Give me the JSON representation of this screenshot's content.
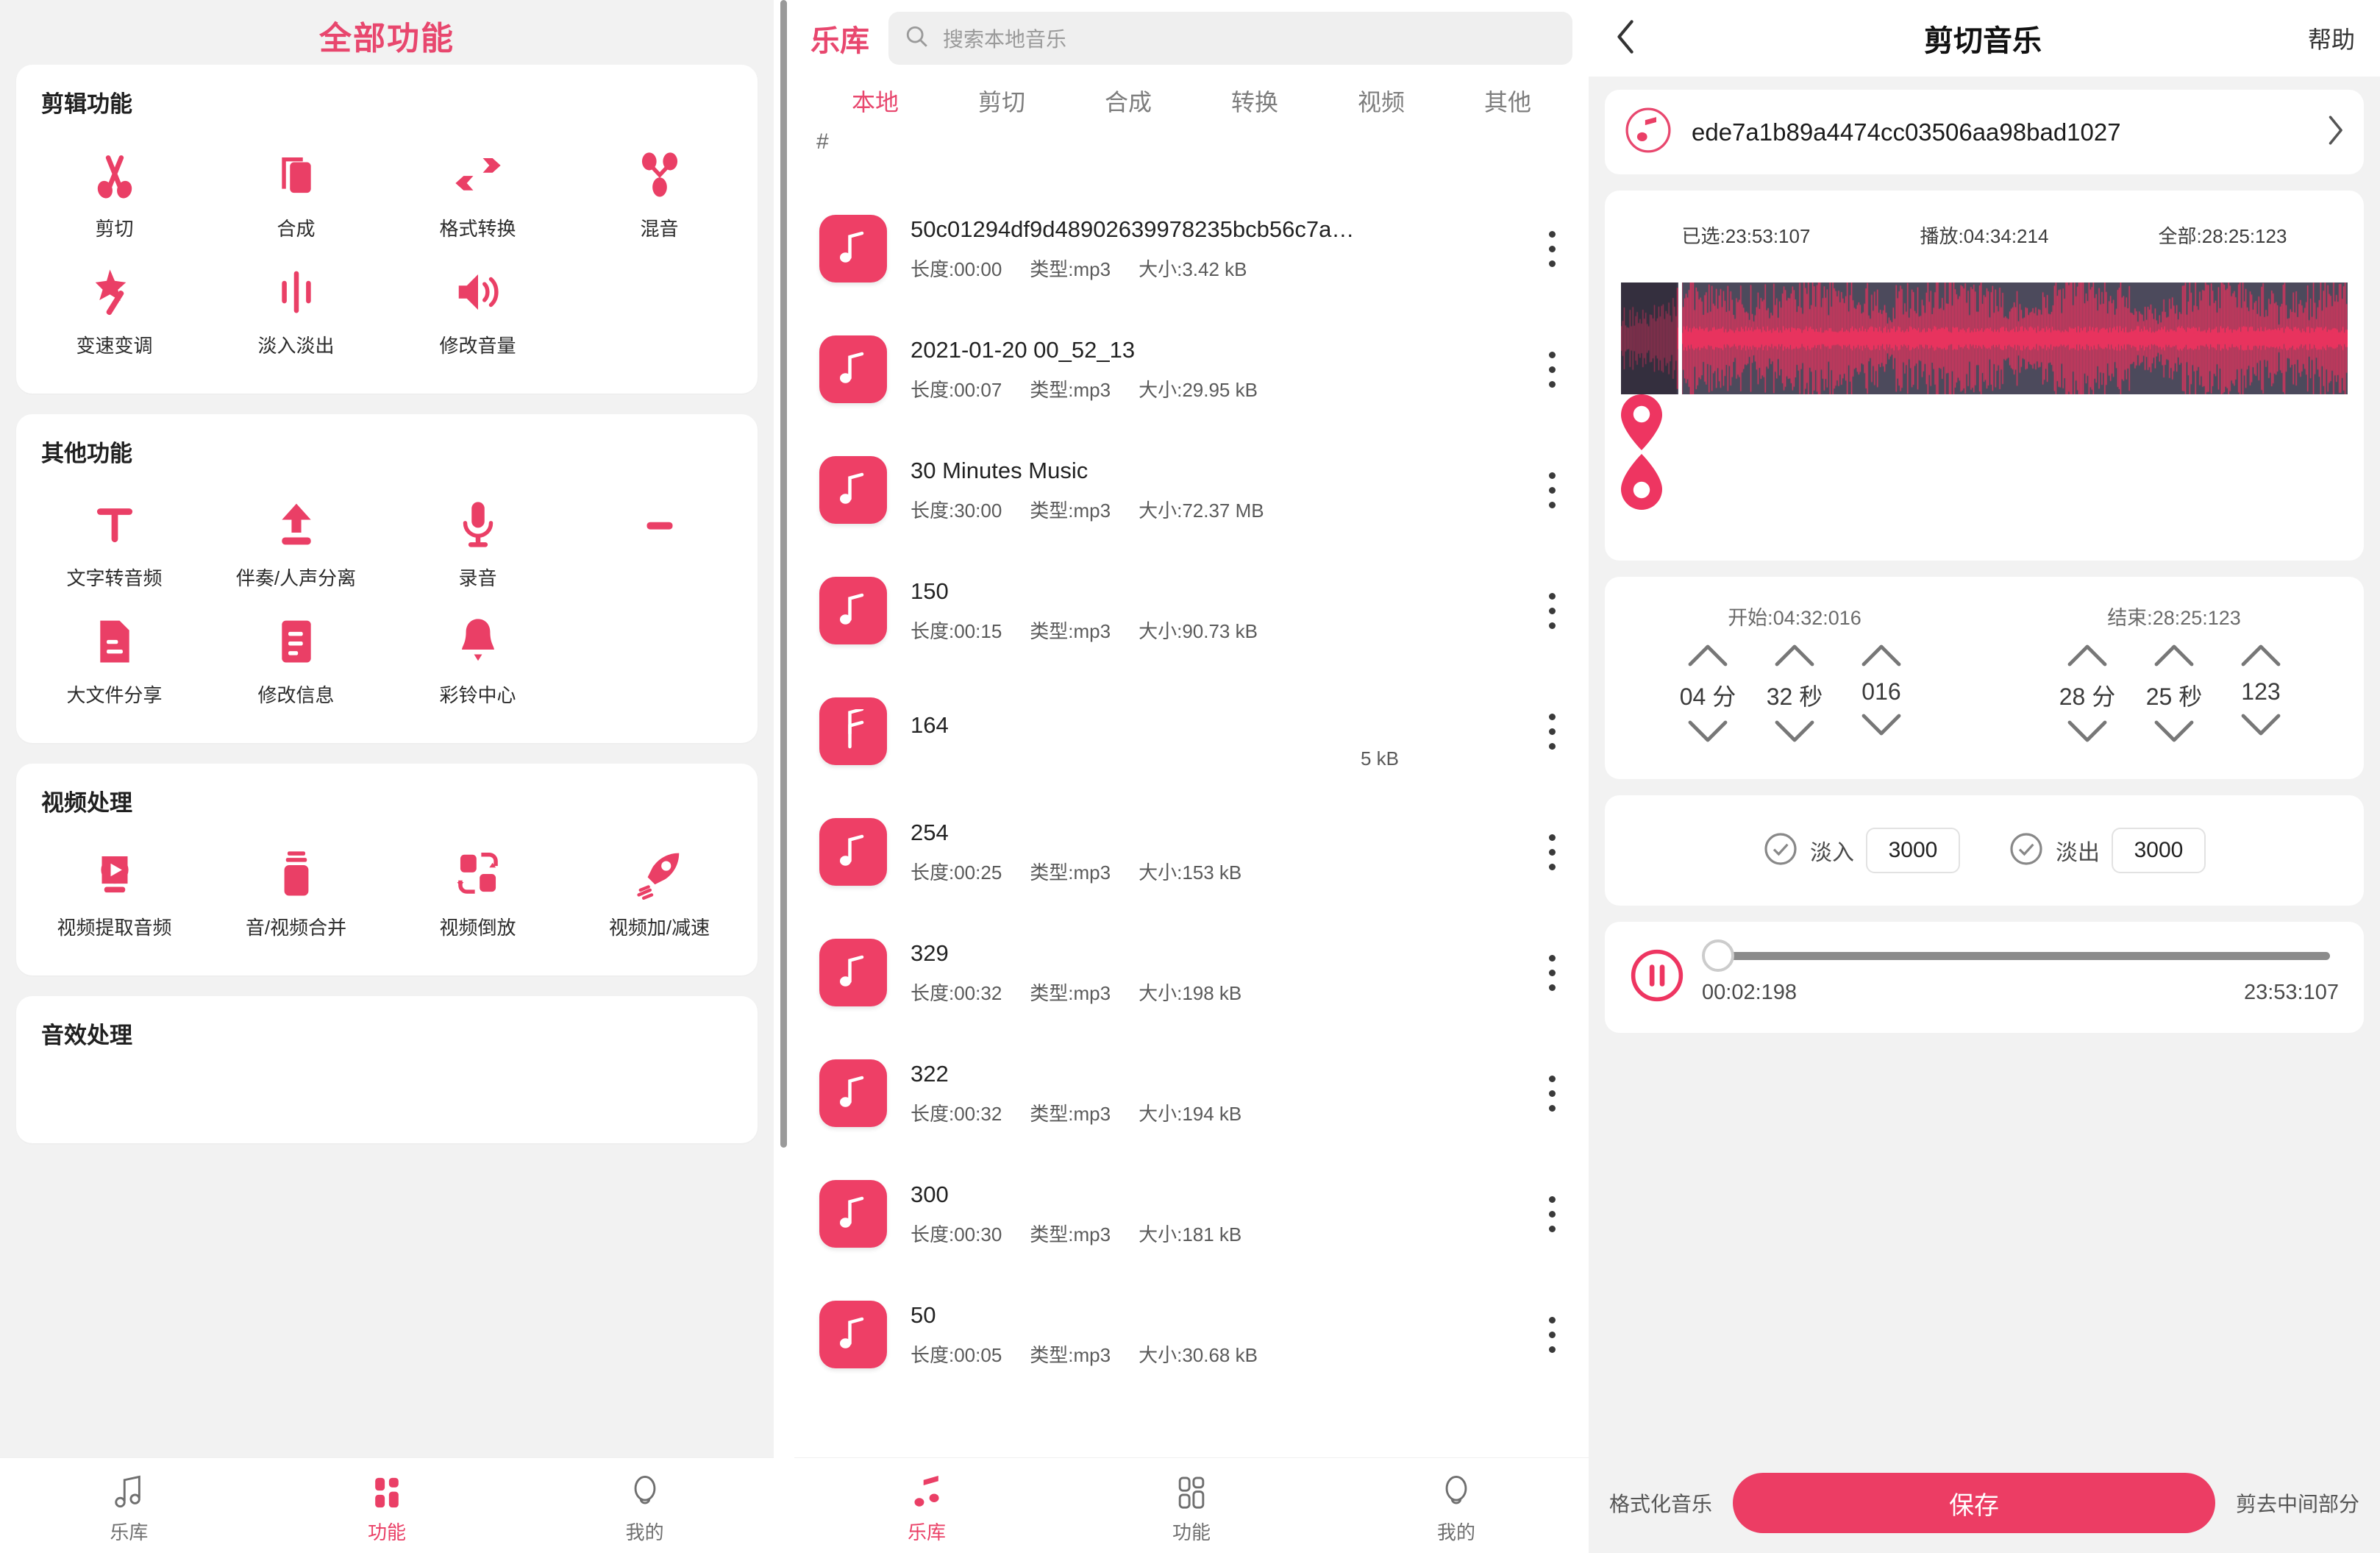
{
  "panel1": {
    "title": "全部功能",
    "sections": [
      {
        "title": "剪辑功能",
        "items": [
          {
            "label": "剪切",
            "icon": "scissors-icon"
          },
          {
            "label": "合成",
            "icon": "merge-icon"
          },
          {
            "label": "格式转换",
            "icon": "convert-icon"
          },
          {
            "label": "混音",
            "icon": "mix-icon"
          },
          {
            "label": "变速变调",
            "icon": "magic-wand-icon"
          },
          {
            "label": "淡入淡出",
            "icon": "fade-icon"
          },
          {
            "label": "修改音量",
            "icon": "volume-icon"
          }
        ]
      },
      {
        "title": "其他功能",
        "items": [
          {
            "label": "文字转音频",
            "icon": "text-icon"
          },
          {
            "label": "伴奏/人声分离",
            "icon": "upload-icon"
          },
          {
            "label": "录音",
            "icon": "microphone-icon"
          },
          {
            "label": "",
            "icon": "dash-icon"
          },
          {
            "label": "大文件分享",
            "icon": "file-share-icon"
          },
          {
            "label": "修改信息",
            "icon": "edit-info-icon"
          },
          {
            "label": "彩铃中心",
            "icon": "bell-icon"
          }
        ]
      },
      {
        "title": "视频处理",
        "items": [
          {
            "label": "视频提取音频",
            "icon": "video-play-icon"
          },
          {
            "label": "音/视频合并",
            "icon": "video-merge-icon"
          },
          {
            "label": "视频倒放",
            "icon": "video-reverse-icon"
          },
          {
            "label": "视频加/减速",
            "icon": "rocket-icon"
          }
        ]
      },
      {
        "title": "音效处理",
        "items": []
      }
    ],
    "tabbar": [
      {
        "label": "乐库",
        "icon": "music-note-icon",
        "active": false
      },
      {
        "label": "功能",
        "icon": "grid-icon",
        "active": true
      },
      {
        "label": "我的",
        "icon": "person-icon",
        "active": false
      }
    ]
  },
  "panel2": {
    "title": "乐库",
    "search": {
      "placeholder": "搜索本地音乐",
      "icon": "search-icon"
    },
    "tabs": [
      {
        "label": "本地",
        "active": true
      },
      {
        "label": "剪切",
        "active": false
      },
      {
        "label": "合成",
        "active": false
      },
      {
        "label": "转换",
        "active": false
      },
      {
        "label": "视频",
        "active": false
      },
      {
        "label": "其他",
        "active": false
      }
    ],
    "index_header": "#",
    "meta_labels": {
      "length": "长度:",
      "type": "类型:",
      "size": "大小:"
    },
    "items": [
      {
        "name": "50c01294df9d48902639978235bcb56c7a…",
        "length": "长度:00:00",
        "type": "类型:mp3",
        "size": "大小:3.42 kB"
      },
      {
        "name": "2021-01-20 00_52_13",
        "length": "长度:00:07",
        "type": "类型:mp3",
        "size": "大小:29.95 kB"
      },
      {
        "name": "30 Minutes Music",
        "length": "长度:30:00",
        "type": "类型:mp3",
        "size": "大小:72.37 MB"
      },
      {
        "name": "150",
        "length": "长度:00:15",
        "type": "类型:mp3",
        "size": "大小:90.73 kB"
      },
      {
        "name": "164",
        "length": "",
        "type": "",
        "size": "5 kB",
        "glitch": true
      },
      {
        "name": "254",
        "length": "长度:00:25",
        "type": "类型:mp3",
        "size": "大小:153 kB"
      },
      {
        "name": "329",
        "length": "长度:00:32",
        "type": "类型:mp3",
        "size": "大小:198 kB"
      },
      {
        "name": "322",
        "length": "长度:00:32",
        "type": "类型:mp3",
        "size": "大小:194 kB"
      },
      {
        "name": "300",
        "length": "长度:00:30",
        "type": "类型:mp3",
        "size": "大小:181 kB"
      },
      {
        "name": "50",
        "length": "长度:00:05",
        "type": "类型:mp3",
        "size": "大小:30.68 kB"
      }
    ],
    "tabbar": [
      {
        "label": "乐库",
        "icon": "music-note-icon",
        "active": true
      },
      {
        "label": "功能",
        "icon": "grid-icon",
        "active": false
      },
      {
        "label": "我的",
        "icon": "person-icon",
        "active": false
      }
    ]
  },
  "panel3": {
    "header": {
      "back_icon": "chevron-left-icon",
      "title": "剪切音乐",
      "help": "帮助"
    },
    "file": {
      "name": "ede7a1b89a4474cc03506aa98bad1027",
      "icon": "music-circle-icon",
      "chevron": "chevron-right-icon"
    },
    "waveform": {
      "selected": "已选:23:53:107",
      "playing": "播放:04:34:214",
      "total": "全部:28:25:123"
    },
    "trim": {
      "start_label": "开始:04:32:016",
      "end_label": "结束:28:25:123",
      "start": {
        "min": "04",
        "min_unit": "分",
        "sec": "32",
        "sec_unit": "秒",
        "ms": "016"
      },
      "end": {
        "min": "28",
        "min_unit": "分",
        "sec": "25",
        "sec_unit": "秒",
        "ms": "123"
      }
    },
    "fade": {
      "in_label": "淡入",
      "in_value": "3000",
      "out_label": "淡出",
      "out_value": "3000",
      "check_icon": "check-circle-icon"
    },
    "player": {
      "button_icon": "pause-icon",
      "current": "00:02:198",
      "duration": "23:53:107"
    },
    "footer": {
      "left": "格式化音乐",
      "save": "保存",
      "right": "剪去中间部分"
    }
  },
  "colors": {
    "accent": "#ea3f66",
    "accent_deep": "#e8476e",
    "text": "#222222",
    "muted": "#7d7d7d",
    "panel_bg": "#f2f2f2",
    "wave_bg": "#4c4a5c",
    "wave_bg_dim": "#342f3e",
    "wave_line": "#e8335e"
  }
}
